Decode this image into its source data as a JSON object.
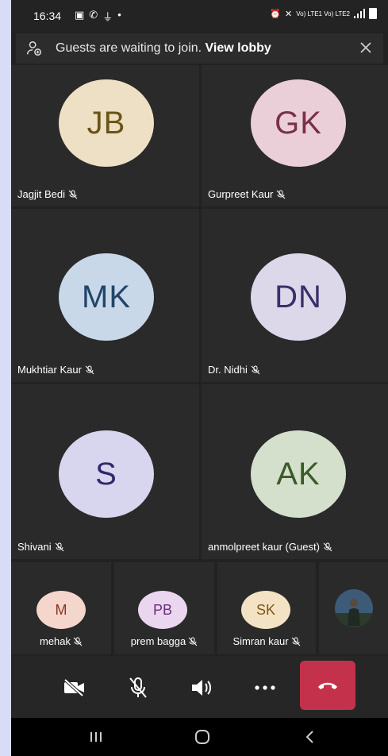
{
  "status_bar": {
    "time": "16:34",
    "network_labels": "Vo) LTE1 Vo) LTE2"
  },
  "banner": {
    "text": "Guests are waiting to join.",
    "link": "View lobby"
  },
  "participants": [
    {
      "initials": "JB",
      "name": "Jagjit Bedi",
      "avatar_bg": "#ede0c4",
      "initials_color": "#6b5415"
    },
    {
      "initials": "GK",
      "name": "Gurpreet Kaur",
      "avatar_bg": "#ebcfd8",
      "initials_color": "#7a3048"
    },
    {
      "initials": "MK",
      "name": "Mukhtiar Kaur",
      "avatar_bg": "#c8d8e8",
      "initials_color": "#21456a"
    },
    {
      "initials": "DN",
      "name": "Dr. Nidhi",
      "avatar_bg": "#ddd7ea",
      "initials_color": "#3a2f6a"
    },
    {
      "initials": "S",
      "name": "Shivani",
      "avatar_bg": "#d8d5ee",
      "initials_color": "#2e2a6a"
    },
    {
      "initials": "AK",
      "name": "anmolpreet kaur (Guest)",
      "avatar_bg": "#d4dfcc",
      "initials_color": "#3b5a2a"
    }
  ],
  "small_participants": [
    {
      "initials": "M",
      "name": "mehak",
      "avatar_bg": "#f5d6cd",
      "initials_color": "#8a3520"
    },
    {
      "initials": "PB",
      "name": "prem bagga",
      "avatar_bg": "#ead6ef",
      "initials_color": "#6a2f7a"
    },
    {
      "initials": "SK",
      "name": "Simran kaur",
      "avatar_bg": "#f3e2c4",
      "initials_color": "#7a5a14"
    }
  ],
  "colors": {
    "end_call": "#c4314b",
    "background": "#222222",
    "page_border": "#d8dcf4"
  },
  "icons": {
    "camera": "camera-off-icon",
    "mic": "mic-off-icon",
    "speaker": "speaker-icon",
    "more": "more-icon",
    "hangup": "hangup-icon"
  }
}
